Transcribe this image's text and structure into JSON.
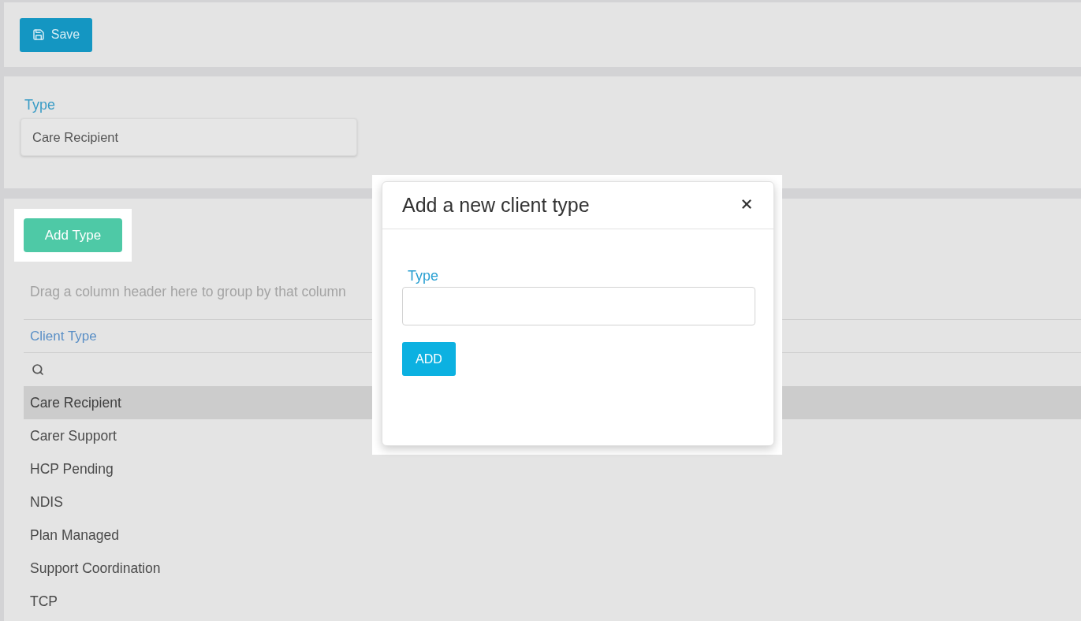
{
  "toolbar": {
    "save_button": "Save"
  },
  "type_panel": {
    "label": "Type",
    "value": "Care Recipient"
  },
  "grid": {
    "add_button": "Add Type",
    "group_hint": "Drag a column header here to group by that column",
    "columns": [
      "Client Type"
    ],
    "rows": [
      {
        "client_type": "Care Recipient",
        "selected": true
      },
      {
        "client_type": "Carer Support",
        "selected": false
      },
      {
        "client_type": "HCP Pending",
        "selected": false
      },
      {
        "client_type": "NDIS",
        "selected": false
      },
      {
        "client_type": "Plan Managed",
        "selected": false
      },
      {
        "client_type": "Support Coordination",
        "selected": false
      },
      {
        "client_type": "TCP",
        "selected": false
      }
    ]
  },
  "dialog": {
    "title": "Add a new client type",
    "field_label": "Type",
    "add_button": "ADD"
  }
}
